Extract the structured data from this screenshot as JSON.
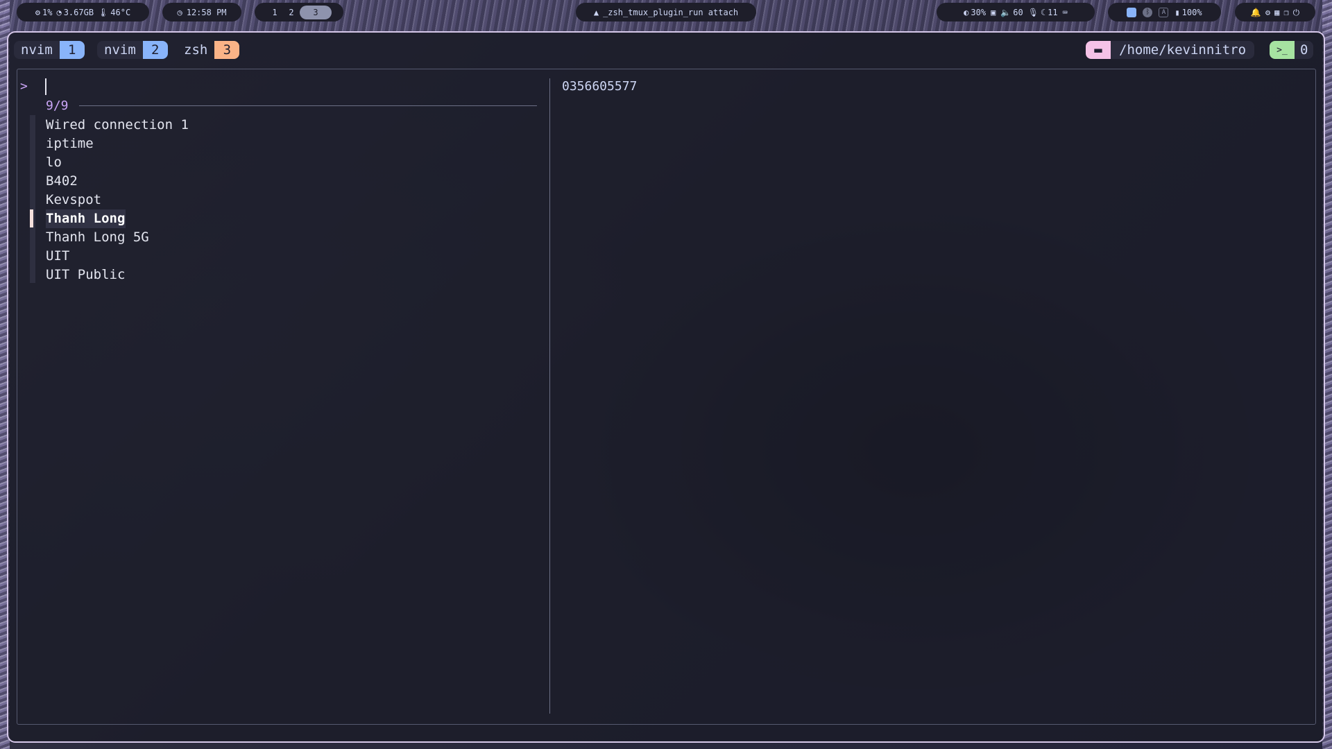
{
  "topbar": {
    "cpu": "1%",
    "memory": "3.67GB",
    "temperature": "46°C",
    "clock": "12:58 PM",
    "workspaces": [
      "1",
      "2",
      "3"
    ],
    "active_workspace": "3",
    "window_title": "_zsh_tmux_plugin_run attach",
    "brightness": "30%",
    "volume": "60",
    "mic": "11",
    "battery": "100%",
    "icons": [
      "cpu-icon",
      "memory-icon",
      "thermometer-icon",
      "clock-icon",
      "arch-icon",
      "brightness-icon",
      "display-icon",
      "volume-icon",
      "mic-icon",
      "moon-icon",
      "keyboard-icon",
      "tray-app-icon",
      "bluetooth-icon",
      "tray-a-icon",
      "battery-icon",
      "notification-icon",
      "settings-icon",
      "layout-icon",
      "clipboard-icon",
      "power-icon"
    ],
    "tray_letter": "A"
  },
  "tmux": {
    "tabs": [
      {
        "name": "nvim",
        "index": "1",
        "color": "#89b4fa"
      },
      {
        "name": "nvim",
        "index": "2",
        "color": "#89b4fa"
      },
      {
        "name": "zsh",
        "index": "3",
        "color": "#fab387"
      }
    ],
    "cwd": "/home/kevinnitro",
    "sessions": "0",
    "cwd_color": "#f5c2e7",
    "sessions_color": "#a6e3a1"
  },
  "fzf": {
    "prompt": ">",
    "query": "",
    "counter": "9/9",
    "items": [
      "Wired connection 1",
      "iptime",
      "lo",
      "B402",
      "Kevspot",
      "Thanh Long",
      "Thanh Long 5G",
      "UIT",
      "UIT Public"
    ],
    "selected_index": 5,
    "preview": "0356605577"
  }
}
